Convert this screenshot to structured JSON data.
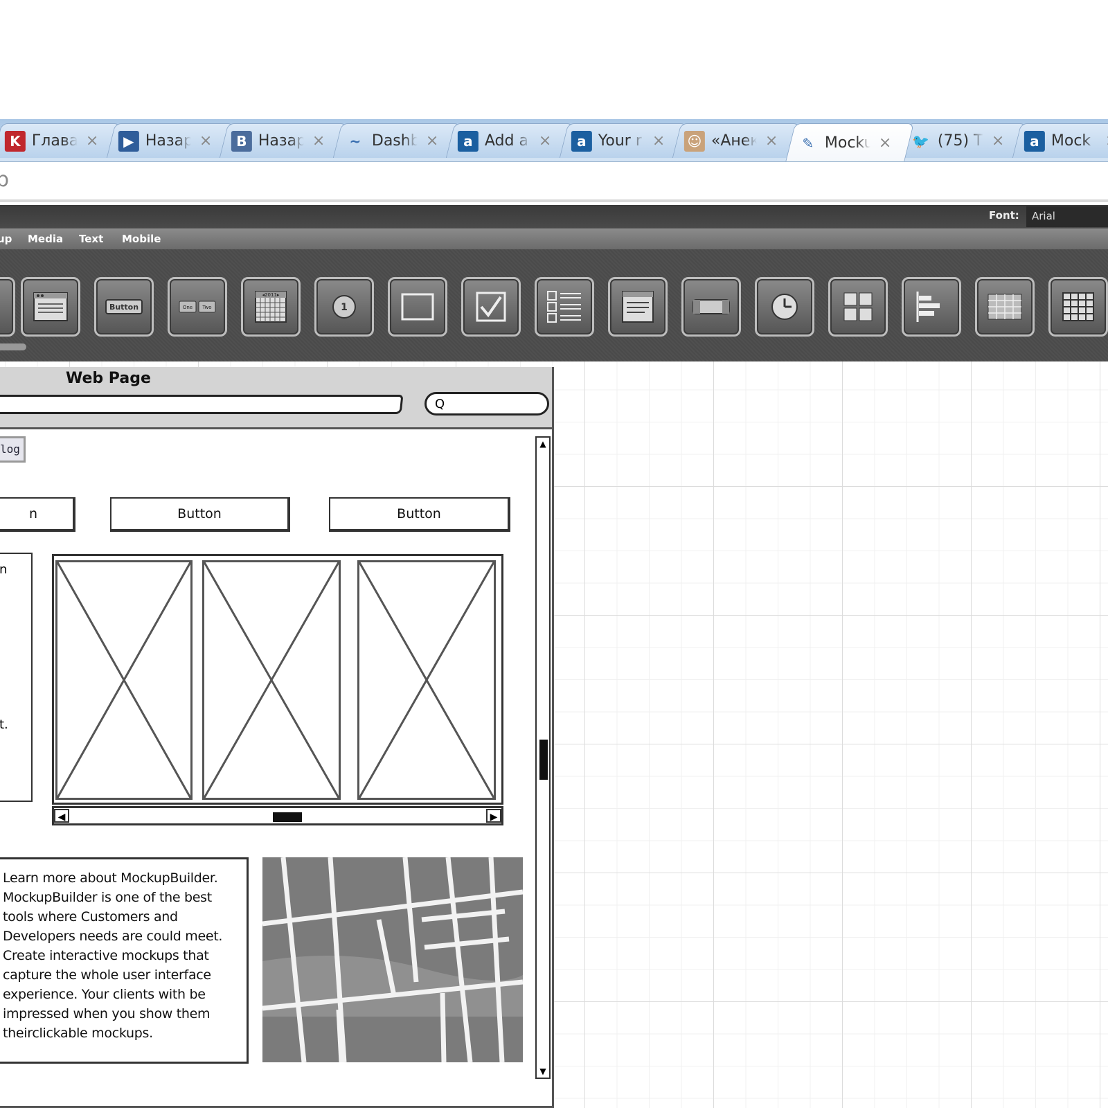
{
  "tabs": [
    {
      "title": "Глава",
      "icon": "K",
      "icon_color": "#c0272d",
      "icon_name": "k-site-icon"
    },
    {
      "title": "Назар",
      "icon": "▶",
      "icon_color": "#2f5d9a",
      "icon_name": "play-icon"
    },
    {
      "title": "Назар",
      "icon": "B",
      "icon_color": "#4b6c9c",
      "icon_name": "vk-icon"
    },
    {
      "title": "Dashb",
      "icon": "~",
      "icon_color": "#ffffff",
      "icon_name": "chart-icon"
    },
    {
      "title": "Add a",
      "icon": "a",
      "icon_color": "#1b5fa0",
      "icon_name": "a-site-icon"
    },
    {
      "title": "Your r",
      "icon": "a",
      "icon_color": "#1b5fa0",
      "icon_name": "a-site-icon"
    },
    {
      "title": "«Анек",
      "icon": "☺",
      "icon_color": "#c9a27a",
      "icon_name": "face-icon"
    },
    {
      "title": "Mocku",
      "icon": "✎",
      "icon_color": "#ffffff",
      "icon_name": "pencil-icon"
    },
    {
      "title": "(75) T",
      "icon": "🐦",
      "icon_color": "#ffffff",
      "icon_name": "twitter-bird-icon"
    },
    {
      "title": "Mock",
      "icon": "a",
      "icon_color": "#1b5fa0",
      "icon_name": "a-site-icon"
    }
  ],
  "tab_close_glyph": "×",
  "address": {
    "text": "p"
  },
  "app": {
    "font_label": "Font:",
    "font_value": "Arial",
    "menu": [
      "up",
      "Media",
      "Text",
      "Mobile"
    ]
  },
  "palette": {
    "button_label": "Button",
    "tab_one": "One",
    "tab_two": "Two",
    "number_label": "1",
    "calendar_label": "◂2011▸"
  },
  "mockup": {
    "title": "Web Page",
    "tab_label": "log",
    "buttons": [
      "n",
      "Button",
      "Button"
    ],
    "left_box_chars": [
      "n",
      "t."
    ],
    "text_lines": [
      "Learn more about MockupBuilder.",
      "MockupBuilder is one of the best",
      "tools where Customers  and",
      " Developers needs are could meet.",
      "Create interactive mockups that",
      "capture the whole user interface",
      "experience. Your clients  with be",
      "impressed when you show them",
      "theirclickable mockups."
    ],
    "scroll_up": "▲",
    "scroll_down": "▼",
    "scroll_left": "◀",
    "scroll_right": "▶",
    "search_glyph": "Q"
  }
}
